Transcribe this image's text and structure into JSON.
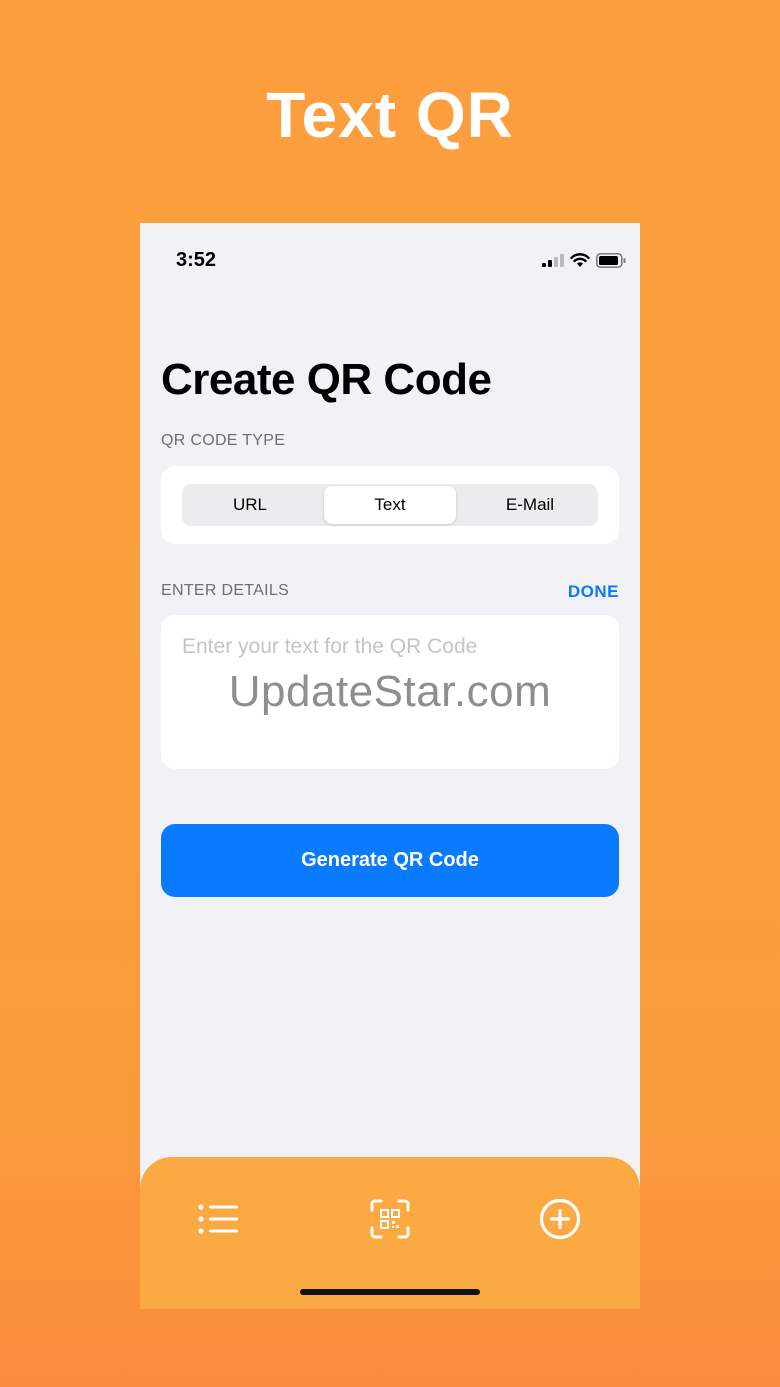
{
  "promo": {
    "title": "Text QR"
  },
  "status_bar": {
    "time": "3:52",
    "icons": [
      "cellular-signal-icon",
      "wifi-icon",
      "battery-icon"
    ]
  },
  "page": {
    "title": "Create QR Code"
  },
  "qr_type": {
    "label": "QR CODE TYPE",
    "segments": [
      "URL",
      "Text",
      "E-Mail"
    ],
    "selected": "Text"
  },
  "details": {
    "label": "ENTER DETAILS",
    "done_label": "DONE",
    "input_value": "",
    "input_placeholder": "Enter your text for the QR Code",
    "watermark": "UpdateStar.com"
  },
  "actions": {
    "generate_label": "Generate QR Code"
  },
  "tab_bar": {
    "tabs": [
      {
        "icon": "list-icon"
      },
      {
        "icon": "qr-scan-icon"
      },
      {
        "icon": "add-circle-icon"
      }
    ]
  },
  "colors": {
    "background": "#fd9e3f",
    "accent": "#0a7aff",
    "tab_bar": "#fbaa43",
    "screen_bg": "#f2f2f6"
  }
}
